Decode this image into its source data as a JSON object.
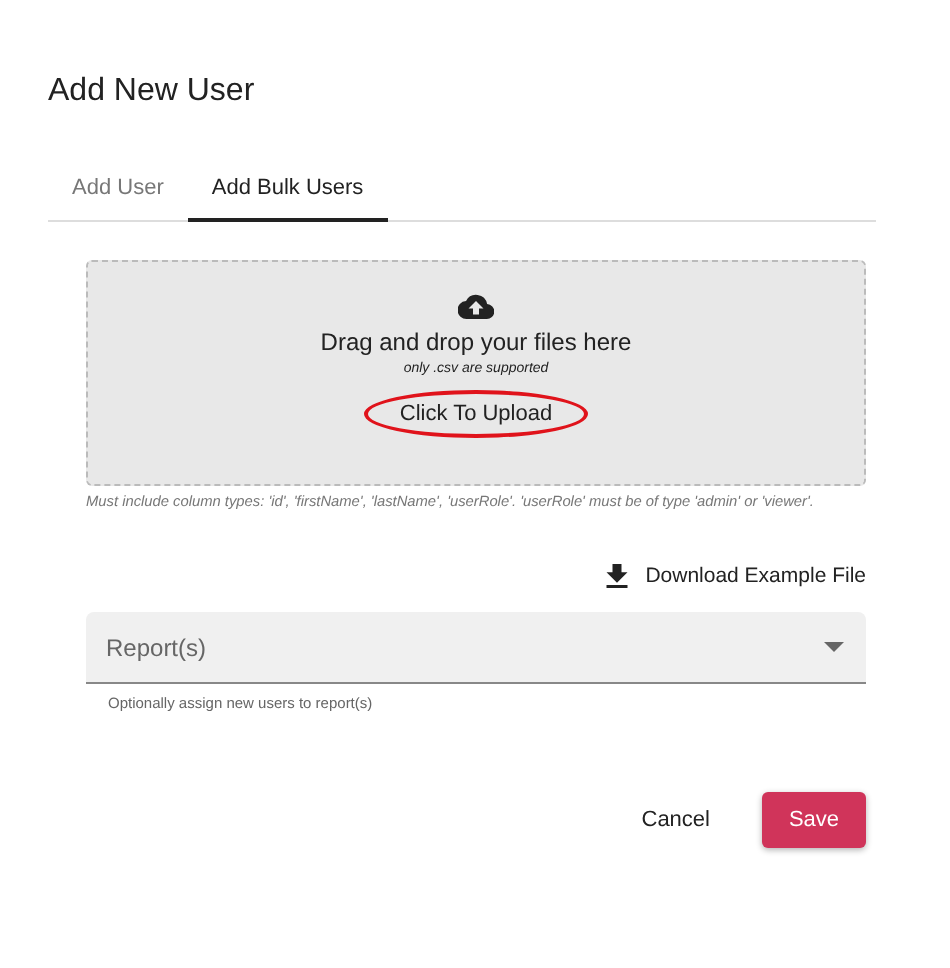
{
  "dialog": {
    "title": "Add New User"
  },
  "tabs": [
    {
      "label": "Add User",
      "selected": false
    },
    {
      "label": "Add Bulk Users",
      "selected": true
    }
  ],
  "dropzone": {
    "heading": "Drag and drop your files here",
    "note": "only .csv are supported",
    "upload_button": {
      "label": "Click To Upload",
      "highlighted": true
    }
  },
  "dropzone_hint": "Must include column types: 'id', 'firstName', 'lastName', 'userRole'. 'userRole' must be of type 'admin' or 'viewer'.",
  "download_link": "Download Example File",
  "reports_select": {
    "placeholder": "Report(s)",
    "helper": "Optionally assign new users to report(s)"
  },
  "buttons": [
    {
      "label": "Cancel",
      "kind": "text"
    },
    {
      "label": "Save",
      "kind": "primary"
    }
  ]
}
